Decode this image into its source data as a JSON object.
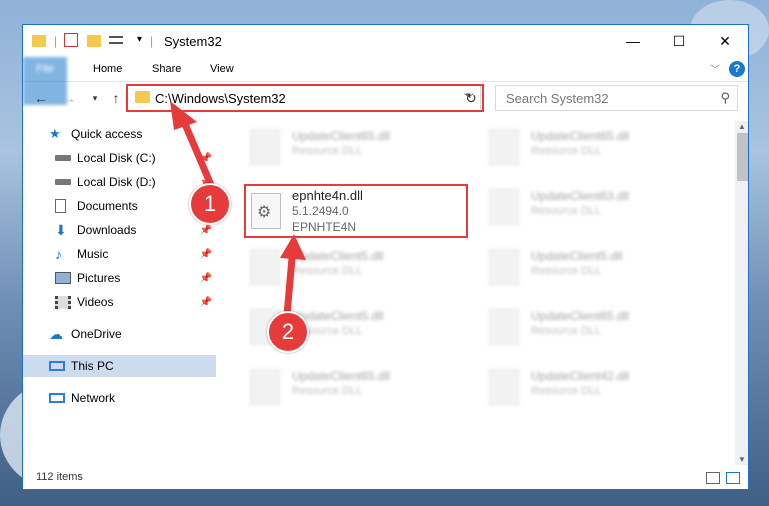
{
  "window": {
    "title": "System32",
    "controls": {
      "minimize": "—",
      "maximize": "☐",
      "close": "✕"
    }
  },
  "ribbon": {
    "tabs": [
      "File",
      "Home",
      "Share",
      "View"
    ],
    "help": "?"
  },
  "address": {
    "path": "C:\\Windows\\System32",
    "search_placeholder": "Search System32"
  },
  "nav": {
    "items": [
      {
        "label": "Quick access",
        "icon": "star-icon",
        "pinned": false
      },
      {
        "label": "Local Disk (C:)",
        "icon": "drive-icon",
        "pinned": true
      },
      {
        "label": "Local Disk (D:)",
        "icon": "drive-icon",
        "pinned": true
      },
      {
        "label": "Documents",
        "icon": "documents-icon",
        "pinned": true
      },
      {
        "label": "Downloads",
        "icon": "downloads-icon",
        "pinned": true
      },
      {
        "label": "Music",
        "icon": "music-icon",
        "pinned": true
      },
      {
        "label": "Pictures",
        "icon": "pictures-icon",
        "pinned": true
      },
      {
        "label": "Videos",
        "icon": "videos-icon",
        "pinned": true
      },
      {
        "label": "OneDrive",
        "icon": "cloud-icon",
        "pinned": false
      },
      {
        "label": "This PC",
        "icon": "computer-icon",
        "pinned": false
      },
      {
        "label": "Network",
        "icon": "network-icon",
        "pinned": false
      }
    ]
  },
  "files": [
    {
      "name": "UpdateClient65.dll",
      "sub": "Resource DLL"
    },
    {
      "name": "UpdateClient65.dll",
      "sub": "Resource DLL"
    },
    {
      "name": "UpdateClient5.dll",
      "sub": "Resource DLL"
    },
    {
      "name": "UpdateClient63.dll",
      "sub": "Resource DLL"
    },
    {
      "name": "UpdateClient5.dll",
      "sub": "Resource DLL"
    },
    {
      "name": "UpdateClient5.dll",
      "sub": "Resource DLL"
    },
    {
      "name": "UpdateClient5.dll",
      "sub": "Resource DLL"
    },
    {
      "name": "UpdateClient65.dll",
      "sub": "Resource DLL"
    },
    {
      "name": "UpdateClient65.dll",
      "sub": "Resource DLL"
    },
    {
      "name": "UpdateClient42.dll",
      "sub": "Resource DLL"
    }
  ],
  "focus_file": {
    "name": "epnhte4n.dll",
    "version": "5.1.2494.0",
    "company": "EPNHTE4N"
  },
  "status": {
    "count": "112 items"
  },
  "callouts": {
    "one": "1",
    "two": "2"
  },
  "colors": {
    "accent": "#1979ca",
    "highlight": "#e53b3b",
    "selected": "#ccdcee"
  }
}
